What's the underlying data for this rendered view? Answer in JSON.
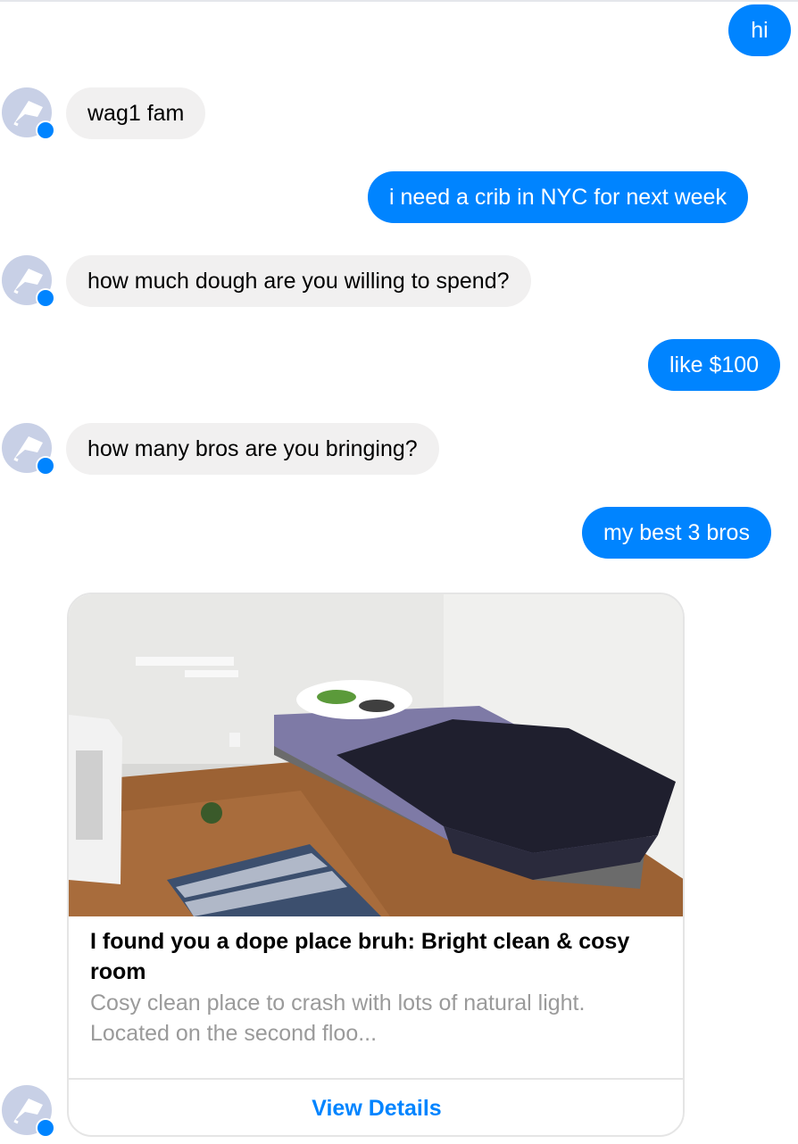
{
  "messages": [
    {
      "text": "hi"
    },
    {
      "text": "wag1 fam"
    },
    {
      "text": "i need a crib in NYC for next week"
    },
    {
      "text": "how much dough are you willing to spend?"
    },
    {
      "text": "like $100"
    },
    {
      "text": "how many bros are you bringing?"
    },
    {
      "text": "my best 3 bros"
    }
  ],
  "card": {
    "title": "I found you a dope place bruh: Bright clean & cosy room",
    "description": "Cosy clean place to crash with lots of natural light. Located on the second floo...",
    "button_label": "View Details",
    "image": "bedroom-photo"
  },
  "colors": {
    "outgoing_bubble": "#0084ff",
    "incoming_bubble": "#f1f0f0",
    "link": "#0084ff",
    "avatar_bg": "#c8d0e6"
  },
  "icons": {
    "avatar": "white-flag-icon",
    "badge": "messenger-badge-icon"
  }
}
